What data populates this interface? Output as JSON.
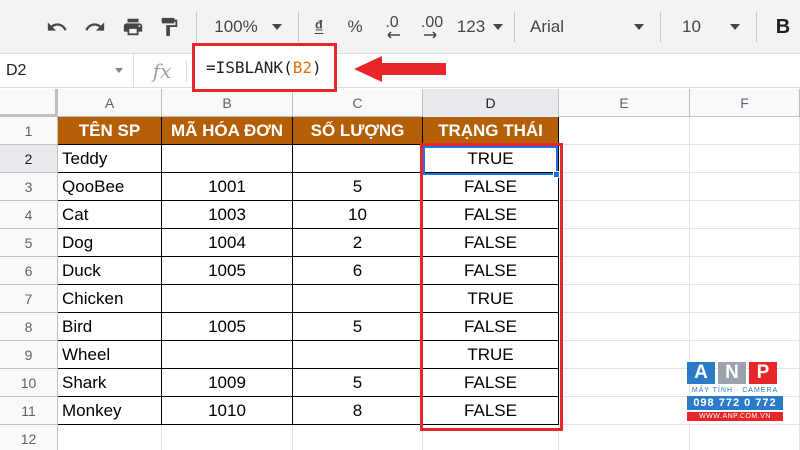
{
  "toolbar": {
    "zoom": "100%",
    "currency": "₫",
    "percent": "%",
    "decrease_decimal": ".0",
    "increase_decimal": ".00",
    "more_formats": "123",
    "font": "Arial",
    "font_size": "10",
    "bold": "B"
  },
  "formula_bar": {
    "name_box": "D2",
    "fx": "fx",
    "formula_prefix": "=ISBLANK(",
    "formula_ref": "B2",
    "formula_suffix": ")"
  },
  "columns": [
    "A",
    "B",
    "C",
    "D",
    "E",
    "F"
  ],
  "rows": [
    "1",
    "2",
    "3",
    "4",
    "5",
    "6",
    "7",
    "8",
    "9",
    "10",
    "11",
    "12"
  ],
  "table": {
    "headers": [
      "TÊN SP",
      "MÃ HÓA ĐƠN",
      "SỐ LƯỢNG",
      "TRẠNG THÁI"
    ],
    "rows": [
      [
        "Teddy",
        "",
        "",
        "TRUE"
      ],
      [
        "QooBee",
        "1001",
        "5",
        "FALSE"
      ],
      [
        "Cat",
        "1003",
        "10",
        "FALSE"
      ],
      [
        "Dog",
        "1004",
        "2",
        "FALSE"
      ],
      [
        "Duck",
        "1005",
        "6",
        "FALSE"
      ],
      [
        "Chicken",
        "",
        "",
        "TRUE"
      ],
      [
        "Bird",
        "1005",
        "5",
        "FALSE"
      ],
      [
        "Wheel",
        "",
        "",
        "TRUE"
      ],
      [
        "Shark",
        "1009",
        "5",
        "FALSE"
      ],
      [
        "Monkey",
        "1010",
        "8",
        "FALSE"
      ]
    ]
  },
  "watermark": {
    "letters": [
      "A",
      "N",
      "P"
    ],
    "tagline": "MÁY TÍNH · CAMERA",
    "phone": "098 772 0 772",
    "website": "WWW.ANP.COM.VN"
  },
  "colors": {
    "header_fill": "#b45f06",
    "highlight_red": "#e8262a",
    "selection_blue": "#1a73e8",
    "formula_ref": "#e8710a"
  }
}
